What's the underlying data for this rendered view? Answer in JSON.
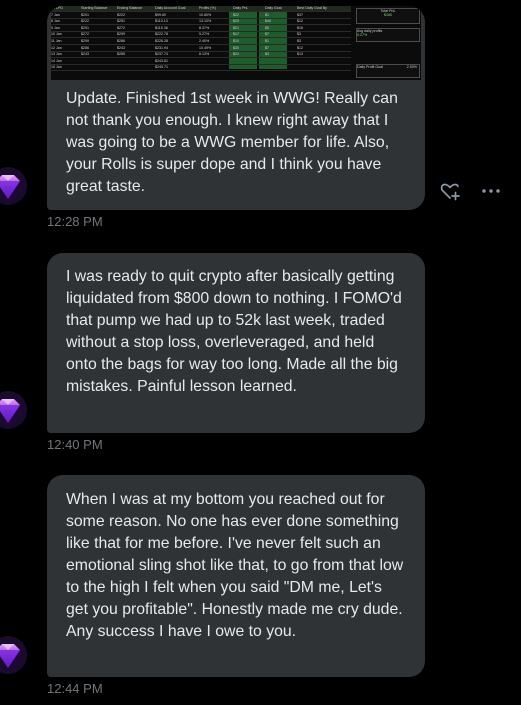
{
  "messages": [
    {
      "text": "Update. Finished 1st week in WWG! Really can not thank you enough. I knew right away that I was going to be a WWG member for life. Also, your Rolls is super dope and I think you have great taste.",
      "time": "12:28 PM",
      "attachment": {
        "headers": [
          "ne LPD",
          "Starting Balance",
          "Ending Balance",
          "Daily Account Goal",
          "Profits (%)",
          "Daily PnL",
          "Daily Goal",
          "Best Daily Goal By",
          "Total PnL"
        ],
        "rows": [
          [
            "7 Jan",
            "$201",
            "$222",
            "$99.60",
            "10.80%",
            "$22",
            "$1",
            "$37",
            "$180"
          ],
          [
            "8 Jan",
            "$222",
            "$251",
            "$110.13",
            "13.10%",
            "$29",
            "$40",
            "$12",
            ""
          ],
          [
            "9 Jan",
            "$251",
            "$272",
            "$115.38",
            "8.37%",
            "$21",
            "$5",
            "$16",
            ""
          ],
          [
            "10 Jan",
            "$272",
            "$299",
            "$222.78",
            "5.27%",
            "$17",
            "$7",
            "$3",
            ""
          ],
          [
            "11 Jan",
            "$299",
            "$286",
            "$226.28",
            "2.40%",
            "$10",
            "$1",
            "$3",
            ""
          ],
          [
            "12 Jan",
            "$286",
            "$243",
            "$231.94",
            "10.49%",
            "$30",
            "$7",
            "$12",
            ""
          ],
          [
            "13 Jan",
            "$243",
            "$285",
            "$237.74",
            "8.13%",
            "$21",
            "$3",
            "$13",
            ""
          ],
          [
            "14 Jan",
            "",
            "",
            "$243.81",
            "",
            "",
            "",
            "",
            ""
          ],
          [
            "15 Jan",
            "",
            "",
            "$249.71",
            "",
            "",
            "",
            "",
            ""
          ]
        ],
        "avg_label": "Avg daily profits",
        "avg_value": "5.27%",
        "goal_label": "Daily Profit Goal",
        "goal_value": "2.50%"
      }
    },
    {
      "text": "I was ready to quit crypto after basically getting liquidated from $800 down to nothing. I FOMO'd that pump we had up to 52k last week, traded without a stop loss, overleveraged, and held onto the bags for way too long. Made all the big mistakes. Painful lesson learned.",
      "time": "12:40 PM"
    },
    {
      "text": "When I was at my bottom you reached out for some reason. No one has ever done something like that for me before. I've never felt such an emotional sling shot like that, to go from that low to the high I felt when you said \"DM me, Let's get you profitable\". Honestly made me cry dude. Any success I have I owe to you.",
      "time": "12:44 PM"
    }
  ],
  "icons": {
    "avatar": "purple-gem-avatar",
    "reaction": "add-reaction-heart-icon",
    "more": "more-options-icon"
  },
  "colors": {
    "background": "#000000",
    "bubble": "#2f3336",
    "text": "#e7e9ea",
    "timestamp": "#71767b",
    "gem_top": "#d07cff",
    "gem_bottom": "#4a1aa8"
  }
}
